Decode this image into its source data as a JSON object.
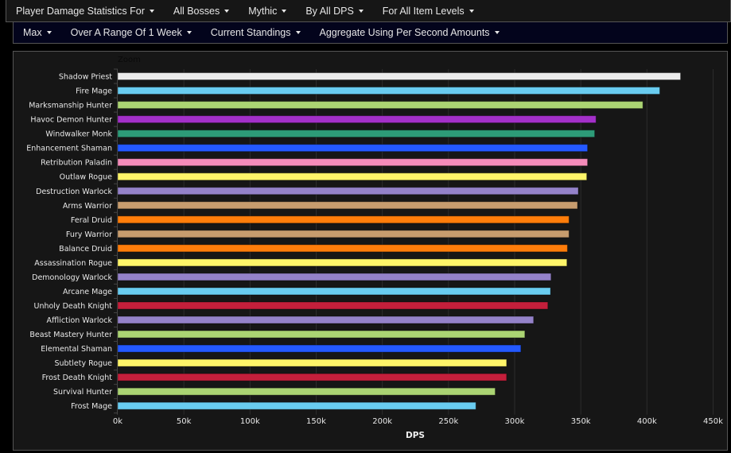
{
  "menu_row1": [
    {
      "label": "Player Damage Statistics For",
      "icon": "caret-down-icon"
    },
    {
      "label": "All Bosses",
      "icon": "caret-down-icon"
    },
    {
      "label": "Mythic",
      "icon": "caret-down-icon"
    },
    {
      "label": "By All DPS",
      "icon": "caret-down-icon"
    },
    {
      "label": "For All Item Levels",
      "icon": "caret-down-icon"
    }
  ],
  "menu_row2": [
    {
      "label": "Max",
      "icon": "caret-down-icon"
    },
    {
      "label": "Over A Range Of 1 Week",
      "icon": "caret-down-icon"
    },
    {
      "label": "Current Standings",
      "icon": "caret-down-icon"
    },
    {
      "label": "Aggregate Using Per Second Amounts",
      "icon": "caret-down-icon"
    }
  ],
  "chart_data": {
    "type": "bar",
    "orientation": "horizontal",
    "title": "",
    "zoom_label": "Zoom",
    "xlabel": "DPS",
    "ylabel": "",
    "xlim": [
      0,
      450000
    ],
    "x_ticks": [
      0,
      50000,
      100000,
      150000,
      200000,
      250000,
      300000,
      350000,
      400000,
      450000
    ],
    "x_tick_labels": [
      "0k",
      "50k",
      "100k",
      "150k",
      "200k",
      "250k",
      "300k",
      "350k",
      "400k",
      "450k"
    ],
    "grid": "vertical",
    "legend": "none",
    "categories": [
      "Shadow Priest",
      "Fire Mage",
      "Marksmanship Hunter",
      "Havoc Demon Hunter",
      "Windwalker Monk",
      "Enhancement Shaman",
      "Retribution Paladin",
      "Outlaw Rogue",
      "Destruction Warlock",
      "Arms Warrior",
      "Feral Druid",
      "Fury Warrior",
      "Balance Druid",
      "Assassination Rogue",
      "Demonology Warlock",
      "Arcane Mage",
      "Unholy Death Knight",
      "Affliction Warlock",
      "Beast Mastery Hunter",
      "Elemental Shaman",
      "Subtlety Rogue",
      "Frost Death Knight",
      "Survival Hunter",
      "Frost Mage"
    ],
    "values": [
      425400,
      409700,
      396900,
      361500,
      360500,
      355100,
      355100,
      354500,
      348100,
      347500,
      341100,
      341100,
      339900,
      339500,
      327500,
      327100,
      325100,
      314300,
      307700,
      304700,
      293900,
      293900,
      285300,
      270700
    ],
    "colors": [
      "#ececec",
      "#69ccf0",
      "#abd473",
      "#a330c9",
      "#2d9b78",
      "#2459ff",
      "#f58cba",
      "#fff569",
      "#9482c9",
      "#c79c6e",
      "#ff7d0a",
      "#c79c6e",
      "#ff7d0a",
      "#fff569",
      "#9482c9",
      "#69ccf0",
      "#c41f3b",
      "#9482c9",
      "#abd473",
      "#2459ff",
      "#fff569",
      "#c41f3b",
      "#abd473",
      "#69ccf0"
    ]
  }
}
